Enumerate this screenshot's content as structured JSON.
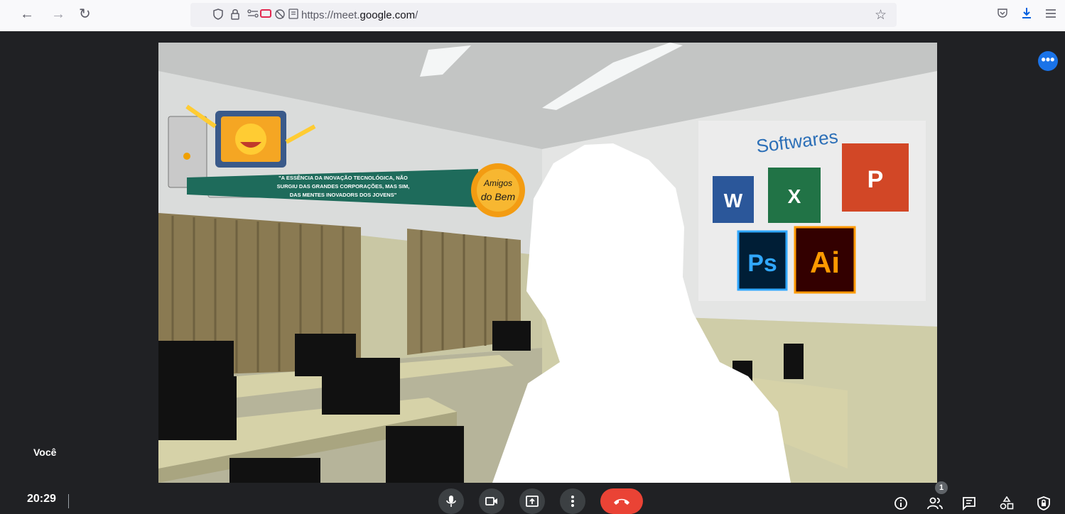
{
  "browser": {
    "nav": {
      "back": "←",
      "forward": "→",
      "reload": "↻"
    },
    "url_host_prefix": "https://meet.",
    "url_host_bold": "google.com",
    "url_suffix": "/",
    "icons": [
      "shield-icon",
      "lock-icon",
      "permissions-icon",
      "camera-sharing-icon",
      "mic-off-icon",
      "reader-view-icon",
      "bookmark-star-icon",
      "pocket-icon",
      "downloads-icon",
      "menu-icon"
    ],
    "download_color": "#0060df"
  },
  "meet": {
    "self_label": "Você",
    "time": "20:29",
    "participants_count": "1",
    "more_options": "•••",
    "accent": "#1a73e8",
    "end_call_color": "#ea4335",
    "controls": [
      "mic-icon",
      "camera-icon",
      "present-icon",
      "more-vert-icon",
      "end-call-icon"
    ],
    "right_icons": [
      "info-icon",
      "people-icon",
      "chat-icon",
      "activities-icon",
      "host-controls-icon"
    ]
  },
  "background": {
    "banner_text": [
      "\"A ESSÊNCIA DA INOVAÇÃO TECNOLÓGICA, NÃO",
      "SURGIU DAS GRANDES CORPORAÇÕES, MAS SIM,",
      "DAS MENTES INOVADORS DOS JOVENS\""
    ],
    "logo_text": [
      "Amigos",
      "do Bem"
    ],
    "wall_title": "Softwares",
    "apps": [
      {
        "label": "W",
        "color": "#2b579a"
      },
      {
        "label": "X",
        "color": "#217346"
      },
      {
        "label": "P",
        "color": "#d24726"
      },
      {
        "label": "Ps",
        "color": "#31a8ff"
      },
      {
        "label": "Ai",
        "color": "#ff9a00"
      }
    ]
  }
}
